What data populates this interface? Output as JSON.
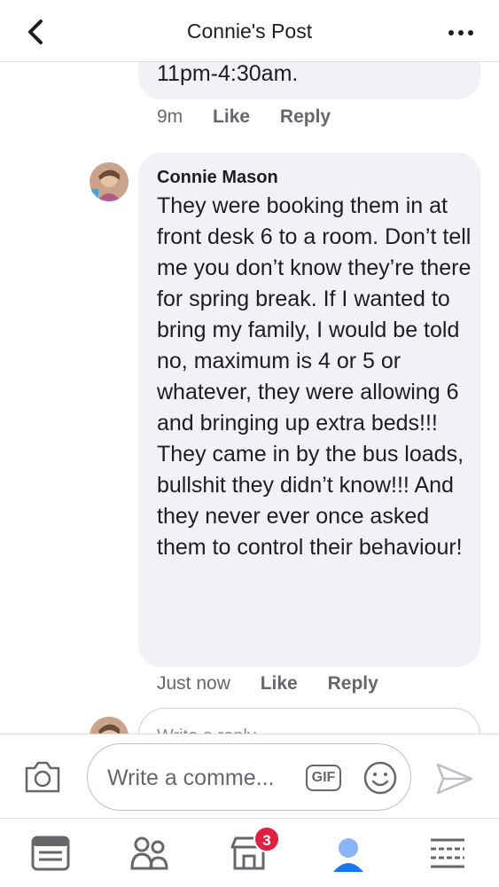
{
  "header": {
    "title": "Connie's Post",
    "back_icon": "chevron-left-icon",
    "more_icon": "more-horizontal-icon"
  },
  "prev_comment": {
    "text_tail": "11pm-4:30am.",
    "time": "9m",
    "like_label": "Like",
    "reply_label": "Reply"
  },
  "comment": {
    "author": "Connie Mason",
    "text": "They were booking them in at front desk 6 to a room. Don’t tell me you don’t know they’re there for spring break. If I wanted to bring my family, I would be told no, maximum is 4 or 5 or whatever, they were allowing 6 and bringing up extra beds!!! They came in by the bus loads, bullshit they didn’t know!!! And they never ever once asked them to control their behaviour!",
    "time": "Just now",
    "like_label": "Like",
    "reply_label": "Reply"
  },
  "reply_box": {
    "placeholder": "Write a reply..."
  },
  "composer": {
    "placeholder": "Write a comme...",
    "gif_label": "GIF",
    "icons": [
      "camera-icon",
      "emoji-icon",
      "send-icon"
    ]
  },
  "tabbar": {
    "tabs": [
      "news-feed-icon",
      "groups-icon",
      "marketplace-icon",
      "profile-icon",
      "menu-icon"
    ],
    "marketplace_badge": "3"
  },
  "colors": {
    "bubble": "#f0f2f5",
    "secondary_text": "#65676b",
    "badge": "#e41e3f",
    "accent": "#1877f2"
  }
}
